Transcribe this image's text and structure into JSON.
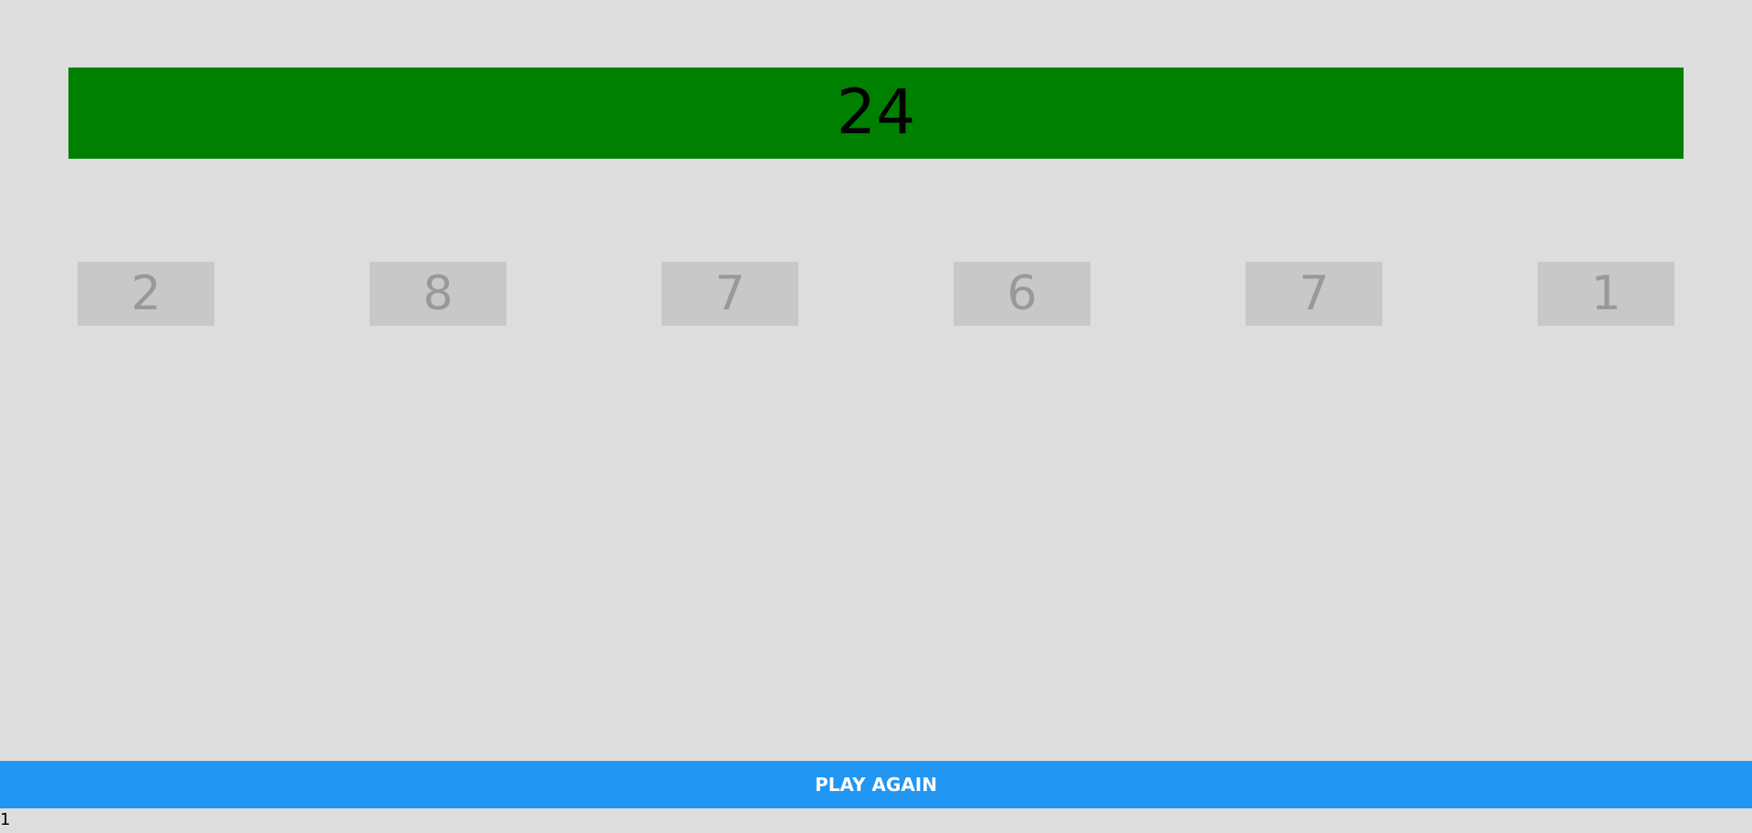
{
  "target": {
    "value": "24",
    "bg_color": "#008000",
    "text_color": "#000000"
  },
  "tiles": {
    "bg_color": "#c8c8c8",
    "text_color": "#999999",
    "items": [
      "2",
      "8",
      "7",
      "6",
      "7",
      "1"
    ]
  },
  "actions": {
    "play_again_label": "PLAY AGAIN",
    "play_again_color": "#2196f3"
  },
  "footer": {
    "counter": "1"
  },
  "colors": {
    "background": "#dddddd"
  }
}
